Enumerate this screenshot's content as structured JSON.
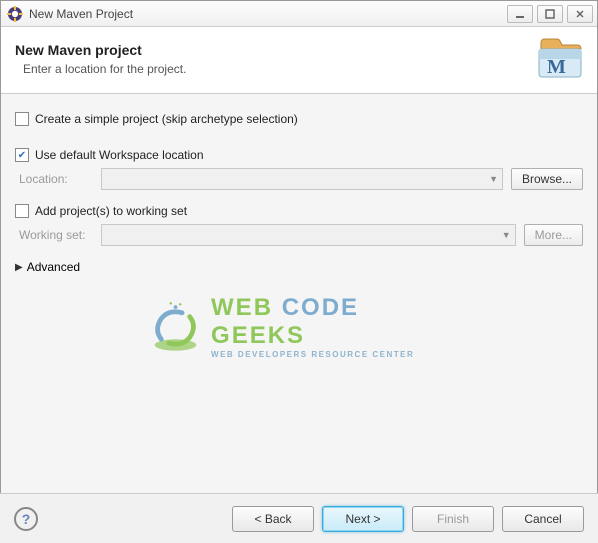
{
  "window": {
    "title": "New Maven Project"
  },
  "header": {
    "title": "New Maven project",
    "subtitle": "Enter a location for the project."
  },
  "form": {
    "simple_project_label": "Create a simple project (skip archetype selection)",
    "simple_project_checked": false,
    "use_default_label": "Use default Workspace location",
    "use_default_checked": true,
    "location_label": "Location:",
    "location_value": "",
    "browse_label": "Browse...",
    "working_set_checkbox_label": "Add project(s) to working set",
    "working_set_checked": false,
    "working_set_label": "Working set:",
    "working_set_value": "",
    "more_label": "More...",
    "advanced_label": "Advanced"
  },
  "watermark": {
    "line1a": "WEB ",
    "line1b": "CODE ",
    "line1c": "GEEKS",
    "line2": "WEB DEVELOPERS RESOURCE CENTER"
  },
  "footer": {
    "back": "< Back",
    "next": "Next >",
    "finish": "Finish",
    "cancel": "Cancel"
  }
}
